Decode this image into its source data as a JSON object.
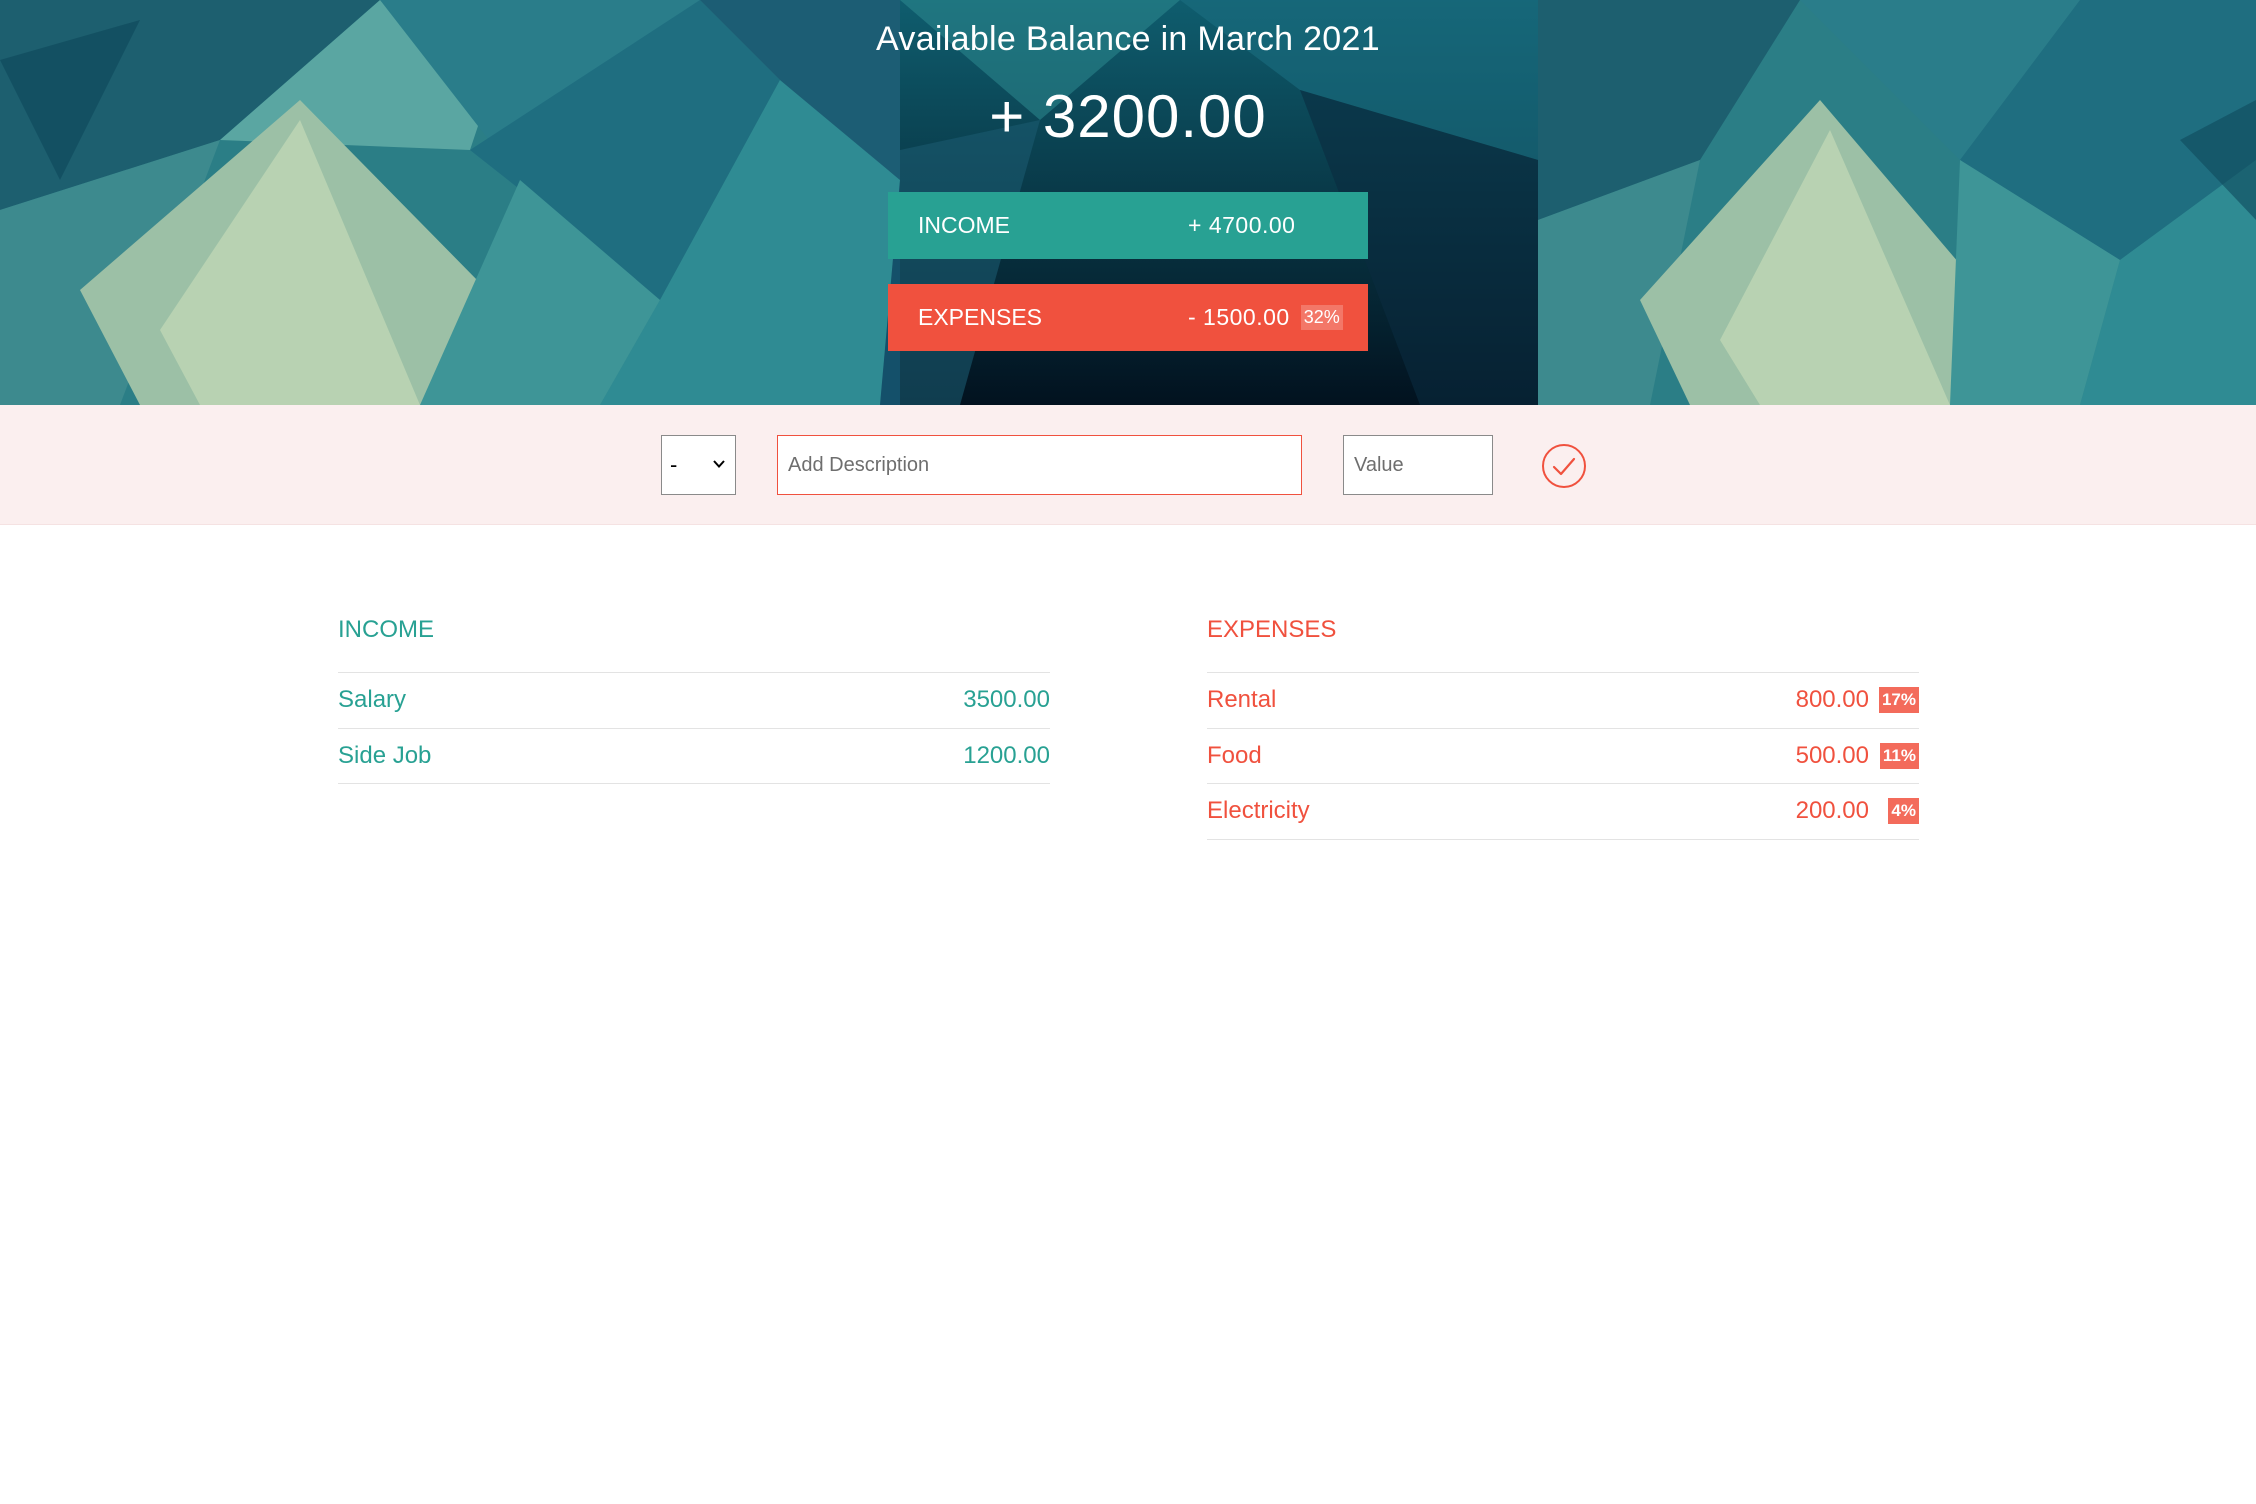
{
  "budget": {
    "title": "Available Balance in March 2021",
    "value": "+ 3200.00",
    "income_label": "Income",
    "income_value": "+ 4700.00",
    "expenses_label": "Expenses",
    "expenses_value": "- 1500.00",
    "expenses_percentage": "32%"
  },
  "add": {
    "type_selected": "-",
    "description_placeholder": "Add Description",
    "description_value": "",
    "value_placeholder": "Value",
    "value_value": ""
  },
  "income": {
    "title": "Income",
    "items": [
      {
        "description": "Salary",
        "value": "3500.00"
      },
      {
        "description": "Side Job",
        "value": "1200.00"
      }
    ]
  },
  "expenses": {
    "title": "Expenses",
    "items": [
      {
        "description": "Rental",
        "value": "800.00",
        "percentage": "17%"
      },
      {
        "description": "Food",
        "value": "500.00",
        "percentage": "11%"
      },
      {
        "description": "Electricity",
        "value": "200.00",
        "percentage": "4%"
      }
    ]
  },
  "colors": {
    "income": "#28a193",
    "expenses": "#f0513e",
    "add_bar_bg": "#fbefef"
  },
  "icons": {
    "add_button": "checkmark-circle-icon",
    "select_arrow": "chevron-down-icon"
  }
}
